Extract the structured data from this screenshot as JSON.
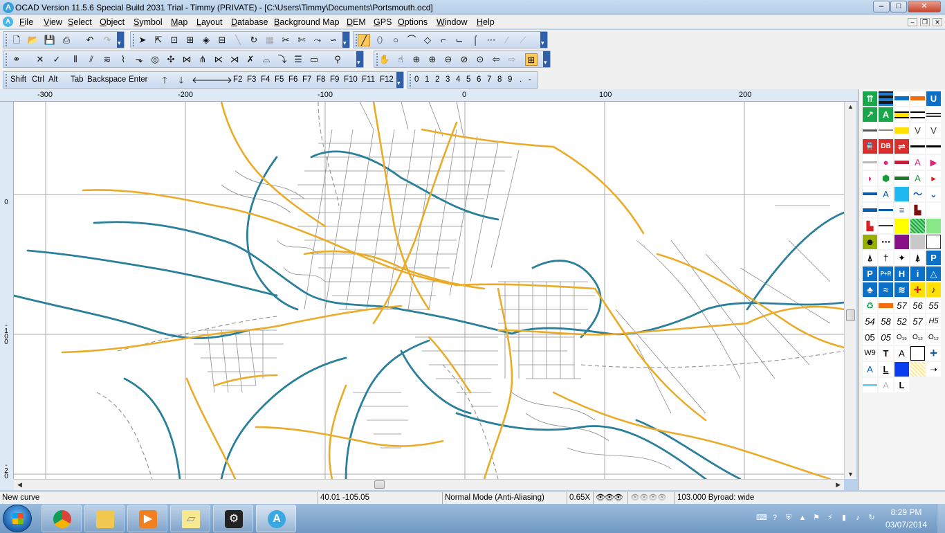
{
  "window": {
    "title": "OCAD Version 11.5.6  Special Build 2031  Trial - Timmy (PRIVATE) - [C:\\Users\\Timmy\\Documents\\Portsmouth.ocd]",
    "app_icon": "A",
    "controls": {
      "minimize": "–",
      "maximize": "□",
      "close": "✕"
    }
  },
  "menubar": {
    "doc_icon": "A",
    "items": [
      "File",
      "View",
      "Select",
      "Object",
      "Symbol",
      "Map",
      "Layout",
      "Database",
      "Background Map",
      "DEM",
      "GPS",
      "Options",
      "Window",
      "Help"
    ],
    "doc_controls": {
      "minimize": "–",
      "restore": "❐",
      "close": "✕"
    }
  },
  "toolbars": {
    "file_icons": [
      "new-file-icon",
      "open-file-icon",
      "save-icon",
      "print-icon",
      "undo-icon",
      "redo-icon"
    ],
    "keyboard_keys": [
      "Shift",
      "Ctrl",
      "Alt"
    ],
    "tab_keys": [
      "Tab",
      "Backspace",
      "Enter"
    ],
    "function_keys": [
      "F2",
      "F3",
      "F4",
      "F5",
      "F6",
      "F7",
      "F8",
      "F9",
      "F10",
      "F11",
      "F12"
    ],
    "number_keys": [
      "0",
      "1",
      "2",
      "3",
      "4",
      "5",
      "6",
      "7",
      "8",
      "9",
      ".",
      "-"
    ],
    "active_tool": "curve-mode-icon"
  },
  "rulers": {
    "top": [
      "-300",
      "-200",
      "-100",
      "0",
      "100",
      "200"
    ],
    "left": [
      "0",
      "-100",
      "-200"
    ]
  },
  "statusbar": {
    "mode_text": "New curve",
    "coordinates": "40.01   -105.05",
    "render_mode": "Normal Mode (Anti-Aliasing)",
    "zoom": "0.65X",
    "symbol_info": "103.000 Byroad: wide"
  },
  "symbols": {
    "labels": [
      "A",
      "A",
      "A",
      "A",
      "P",
      "H",
      "i",
      "57",
      "56",
      "55",
      "54",
      "58",
      "52",
      "57",
      "H5",
      "05",
      "05",
      "W9",
      "T",
      "A",
      "A",
      "L",
      "A",
      "L"
    ]
  },
  "taskbar": {
    "apps": [
      "file-explorer-icon",
      "chrome-icon",
      "windows-explorer-icon",
      "media-player-icon",
      "sticky-notes-icon",
      "steam-icon",
      "ocad-icon"
    ],
    "time": "8:29 PM",
    "date": "03/07/2014"
  },
  "colors": {
    "road_major": "#e9ab28",
    "water": "#2a7f9a",
    "street": "#8a8a8a",
    "grid": "#a9a9a9"
  }
}
